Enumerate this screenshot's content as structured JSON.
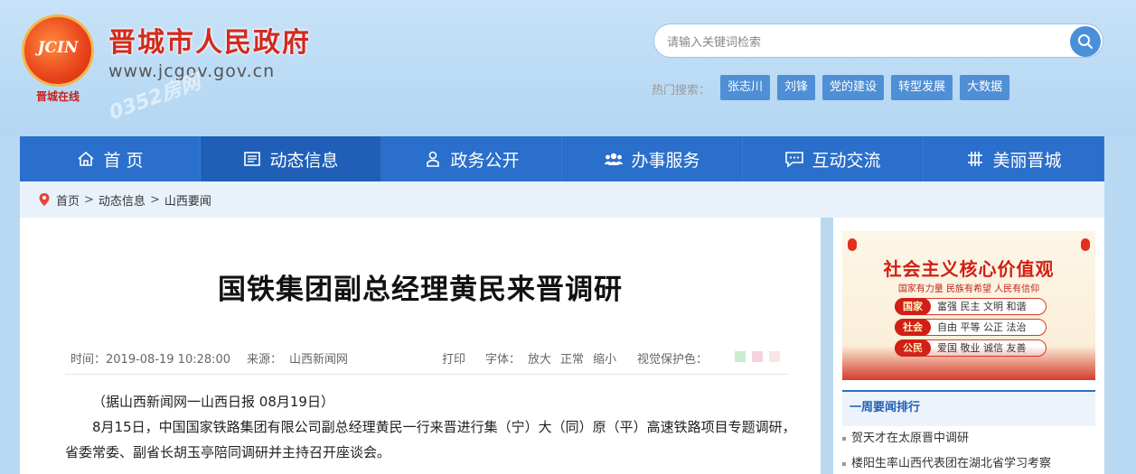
{
  "header": {
    "logo_text": "JCIN",
    "logo_caption": "晋城在线",
    "site_title": "晋城市人民政府",
    "site_url": "www.jcgov.gov.cn",
    "watermark": "0352房网"
  },
  "search": {
    "placeholder": "请输入关键词检索",
    "hot_label": "热门搜索：",
    "hot_tags": [
      "张志川",
      "刘锋",
      "党的建设",
      "转型发展",
      "大数据"
    ]
  },
  "nav": {
    "items": [
      {
        "label": "首 页",
        "icon": "home-icon"
      },
      {
        "label": "动态信息",
        "icon": "news-icon"
      },
      {
        "label": "政务公开",
        "icon": "person-icon"
      },
      {
        "label": "办事服务",
        "icon": "group-icon"
      },
      {
        "label": "互动交流",
        "icon": "chat-icon"
      },
      {
        "label": "美丽晋城",
        "icon": "grid-icon"
      }
    ],
    "active_index": 1
  },
  "breadcrumb": [
    "首页",
    "动态信息",
    "山西要闻"
  ],
  "article": {
    "title": "国铁集团副总经理黄民来晋调研",
    "time": "时间：2019-08-19 10:28:00",
    "source": "来源：",
    "source_name": "山西新闻网",
    "print": "打印",
    "font_label": "字体：",
    "font_large": "放大",
    "font_normal": "正常",
    "font_small": "缩小",
    "vision_label": "视觉保护色：",
    "vision_colors": [
      "#cdebd0",
      "#f5d3dc",
      "#f8e6e6"
    ],
    "body": [
      "（据山西新闻网一山西日报 08月19日）",
      "8月15日，中国国家铁路集团有限公司副总经理黄民一行来晋进行集（宁）大（同）原（平）高速铁路项目专题调研，省委常委、副省长胡玉亭陪同调研并主持召开座谈会。"
    ]
  },
  "sidebar": {
    "banner": {
      "title": "社会主义核心价值观",
      "subtitle": "国家有力量 民族有希望 人民有信仰",
      "rows": [
        {
          "tag": "国家",
          "text": "富强  民主  文明  和谐"
        },
        {
          "tag": "社会",
          "text": "自由  平等  公正  法治"
        },
        {
          "tag": "公民",
          "text": "爱国  敬业  诚信  友善"
        }
      ]
    },
    "rank_title": "一周要闻排行",
    "rank_items": [
      "贺天才在太原晋中调研",
      "楼阳生率山西代表团在湖北省学习考察"
    ]
  }
}
